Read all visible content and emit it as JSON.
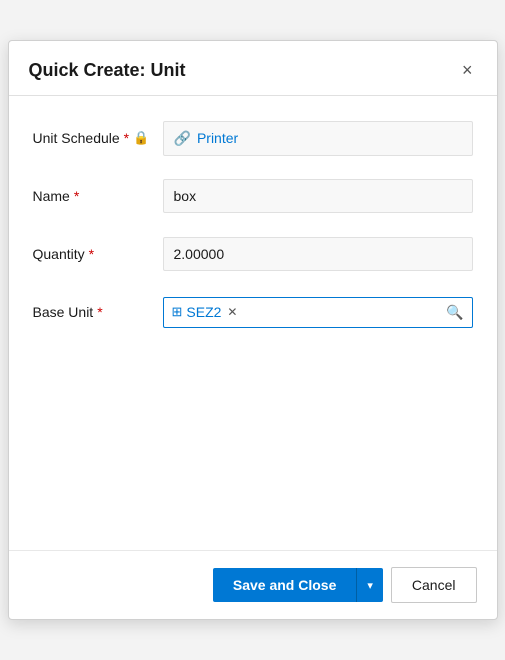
{
  "dialog": {
    "title": "Quick Create: Unit",
    "close_label": "×"
  },
  "form": {
    "unit_schedule": {
      "label": "Unit Schedule",
      "required": true,
      "locked": true,
      "value": "Printer",
      "link_icon": "🔗"
    },
    "name": {
      "label": "Name",
      "required": true,
      "value": "box"
    },
    "quantity": {
      "label": "Quantity",
      "required": true,
      "value": "2.00000"
    },
    "base_unit": {
      "label": "Base Unit",
      "required": true,
      "tag_text": "SEZ2"
    }
  },
  "footer": {
    "save_label": "Save and Close",
    "chevron": "▾",
    "cancel_label": "Cancel"
  }
}
